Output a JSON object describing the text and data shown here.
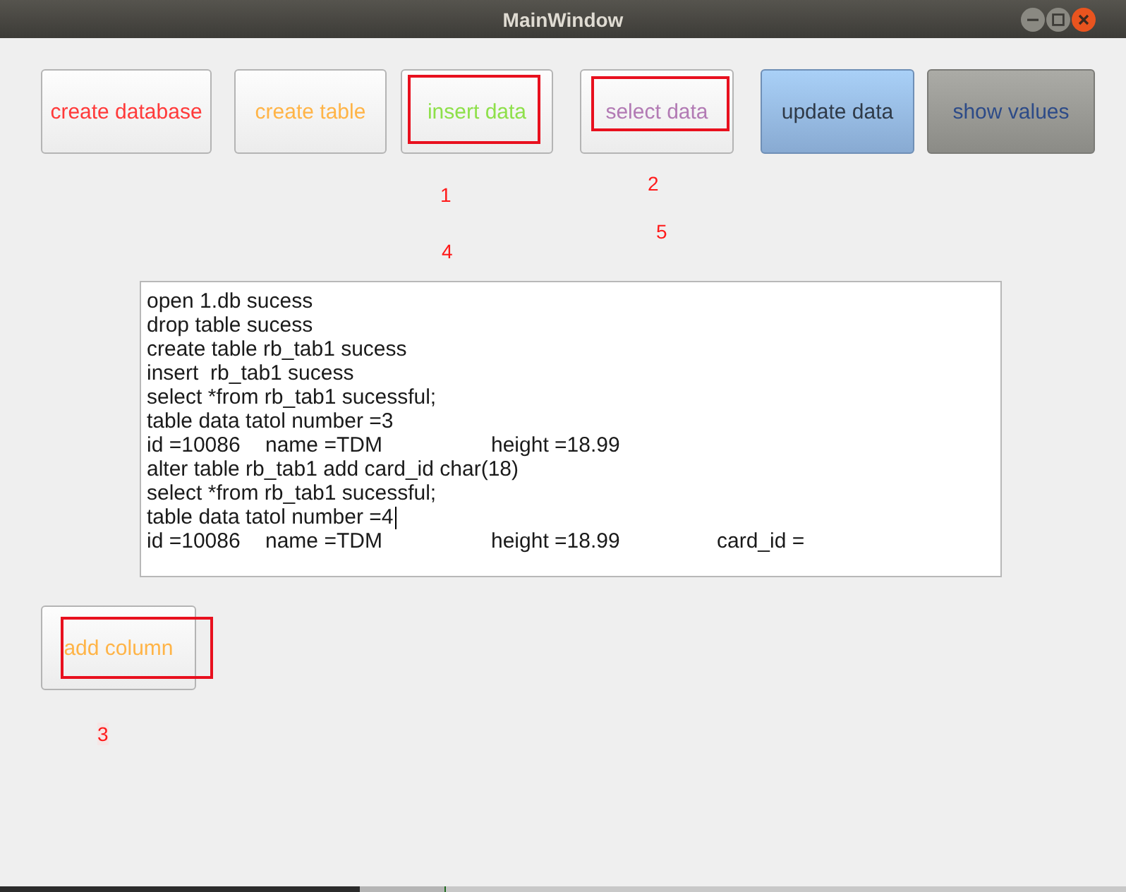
{
  "window": {
    "title": "MainWindow"
  },
  "toolbar": [
    {
      "label": "create database",
      "color": "#ff3a3a",
      "kind": "plain",
      "highlighted": false
    },
    {
      "label": "create table",
      "color": "#ffb447",
      "kind": "plain",
      "highlighted": false
    },
    {
      "label": "insert data",
      "color": "#8ee04a",
      "kind": "plain",
      "highlighted": true
    },
    {
      "label": "select data",
      "color": "#b27ab4",
      "kind": "plain",
      "highlighted": true
    },
    {
      "label": "update data",
      "color": "#2f3a48",
      "kind": "tinted",
      "highlighted": false
    },
    {
      "label": "show values",
      "color": "#2d4b88",
      "kind": "shaded",
      "highlighted": false
    }
  ],
  "log": {
    "lines": [
      {
        "kind": "text",
        "text": "open 1.db sucess",
        "cursor": false
      },
      {
        "kind": "text",
        "text": "drop table sucess",
        "cursor": false
      },
      {
        "kind": "text",
        "text": "create table rb_tab1 sucess",
        "cursor": false
      },
      {
        "kind": "text",
        "text": "insert  rb_tab1 sucess",
        "cursor": false
      },
      {
        "kind": "text",
        "text": "select *from rb_tab1 sucessful;",
        "cursor": false
      },
      {
        "kind": "text",
        "text": "table data tatol number =3",
        "cursor": false
      },
      {
        "kind": "fields",
        "fields": [
          "id =10086",
          "name =TDM",
          "height =18.99"
        ],
        "cursor": false
      },
      {
        "kind": "text",
        "text": "alter table rb_tab1 add card_id char(18)",
        "cursor": false
      },
      {
        "kind": "text",
        "text": "select *from rb_tab1 sucessful;",
        "cursor": false
      },
      {
        "kind": "text",
        "text": "table data tatol number =4",
        "cursor": true
      },
      {
        "kind": "fields",
        "fields": [
          "id =10086",
          "name =TDM",
          "height =18.99",
          "card_id ="
        ],
        "cursor": false
      }
    ]
  },
  "side_button": {
    "label": "add column",
    "color": "#ffb447",
    "kind": "plain",
    "highlighted": true
  },
  "annotations": [
    "2",
    "1",
    "5",
    "4",
    "3"
  ]
}
